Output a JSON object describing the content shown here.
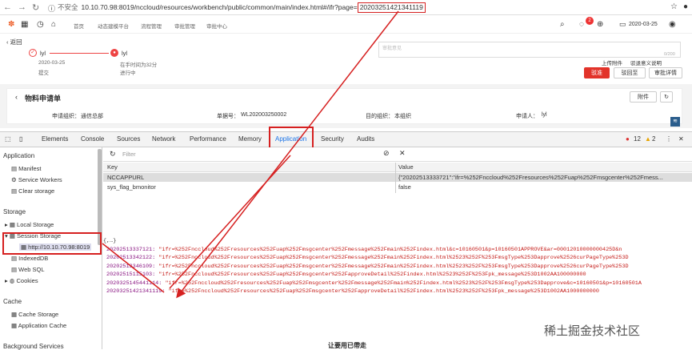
{
  "address_bar": {
    "insecure_label": "不安全",
    "url_prefix": "10.10.70.98:8019/nccloud/resources/workbench/public/common/main/index.html#/ifr?page=",
    "url_highlight": "20203251421341119"
  },
  "app_header": {
    "breadcrumb": [
      "首页",
      "动态建模平台",
      "流程管理",
      "审批管理",
      "审批中心"
    ],
    "badge": "2",
    "date": "2020-03-25"
  },
  "flow": {
    "back": "返回",
    "step1_user": "lyl",
    "step1_date": "2020-03-25",
    "step1_action": "提交",
    "step2_user": "lyl",
    "step2_wait": "在手时间为32分",
    "step2_status": "进行中",
    "remark_placeholder": "审批意见",
    "counter": "0/200",
    "upload": "上传附件",
    "reset": "驳退意义说明",
    "reject": "驳准",
    "back_to": "驳回至",
    "detail": "审批详情"
  },
  "card": {
    "title": "物料申请单",
    "attach": "附件",
    "org_label": "申请组织：",
    "org_value": "通信总部",
    "no_label": "单据号：",
    "no_value": "WL202003250002",
    "target_label": "目的组织：",
    "target_value": "本组织",
    "applicant_label": "申请人：",
    "applicant_value": "lyl"
  },
  "devtools": {
    "tabs": [
      "Elements",
      "Console",
      "Sources",
      "Network",
      "Performance",
      "Memory",
      "Application",
      "Security",
      "Audits"
    ],
    "errors": "12",
    "warnings": "2",
    "filter_placeholder": "Filter"
  },
  "sidebar": {
    "application": "Application",
    "manifest": "Manifest",
    "service_workers": "Service Workers",
    "clear_storage": "Clear storage",
    "storage": "Storage",
    "local_storage": "Local Storage",
    "session_storage": "Session Storage",
    "session_origin": "http://10.10.70.98:8019",
    "indexeddb": "IndexedDB",
    "websql": "Web SQL",
    "cookies": "Cookies",
    "cache": "Cache",
    "cache_storage": "Cache Storage",
    "app_cache": "Application Cache",
    "bg": "Background Services"
  },
  "table": {
    "col_key": "Key",
    "col_value": "Value",
    "rows": [
      {
        "key": "NCCAPPURL",
        "value": "{\"20202513333721\":\"ifr=%252Fnccloud%252Fresources%252Fuap%252Fmsgcenter%252Fmess..."
      },
      {
        "key": "sys_flag_bmonitor",
        "value": "false"
      }
    ]
  },
  "json": {
    "open": "{,…}",
    "lines": [
      {
        "k": "20202513337121:",
        "v": "\"ifr=%252Fnccloud%252Fresources%252Fuap%252Fmsgcenter%252Fmessage%252Fmain%252Findex.html&c=10160501&p=10160501APPROVE&ar=00012010000000425D&n"
      },
      {
        "k": "20202513342122:",
        "v": "\"ifr=%252Fnccloud%252Fresources%252Fuap%252Fmsgcenter%252Fmessage%252Fmain%252Findex.html%2523%252F%253FmsgType%253Dapprove%2526curPageType%253D"
      },
      {
        "k": "20202513346109:",
        "v": "\"ifr=%252Fnccloud%252Fresources%252Fuap%252Fmsgcenter%252Fmessage%252Fmain%252Findex.html%2523%252F%253FmsgType%253Dapprove%2526curPageType%253D"
      },
      {
        "k": "20202515115103:",
        "v": "\"ifr=%252Fnccloud%252Fresources%252Fuap%252Fmsgcenter%252FapproveDetail%252Findex.html%2523%252F%253Fpk_message%253D1002AA100000000"
      },
      {
        "k": "2020325145441114:",
        "v": "\"ifr=%252Fnccloud%252Fresources%252Fuap%252Fmsgcenter%252Fmessage%252Fmain%252Findex.html%2523%252F%253FmsgType%253Dapprove&c=10160501&p=10160501A"
      },
      {
        "k": "20203251421341119:",
        "v": "\"ifr=%252Fnccloud%252Fresources%252Fuap%252Fmsgcenter%252FapproveDetail%252Findex.html%2523%252F%253Fpk_message%253D1002AA1000000000"
      }
    ]
  },
  "footer": "让要用已帶走",
  "watermark": "稀土掘金技术社区"
}
